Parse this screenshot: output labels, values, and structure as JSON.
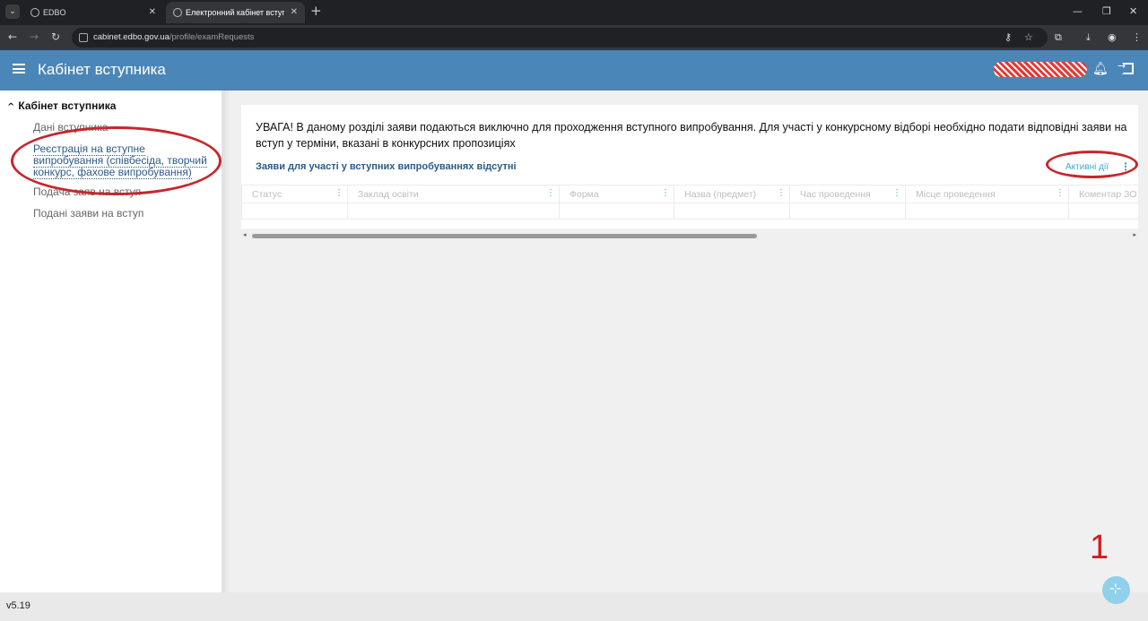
{
  "browser": {
    "tabs": [
      {
        "title": "EDBO"
      },
      {
        "title": "Електронний кабінет вступника"
      }
    ],
    "url_host": "cabinet.edbo.gov.ua",
    "url_path": "/profile/examRequests"
  },
  "header": {
    "title": "Кабінет вступника",
    "icons": [
      "menu-icon",
      "bell-icon",
      "logout-icon"
    ]
  },
  "sidebar": {
    "heading": "Кабінет вступника",
    "items": [
      {
        "label": "Дані вступника"
      },
      {
        "label": "Реєстрація на вступне випробування (співбесіда, творчий конкурс, фахове випробування)"
      },
      {
        "label": "Подача заяв на вступ"
      },
      {
        "label": "Подані заяви на вступ"
      }
    ]
  },
  "main": {
    "warning": "УВАГА! В даному розділі заяви подаються виключно для проходження вступного випробування. Для участі у конкурсному відборі необхідно подати відповідні заяви на вступ у терміни, вказані в конкурсних пропозиціях",
    "empty_title": "Заяви для участі у вступних випробуваннях відсутні",
    "actions_label": "Активні дії",
    "columns": [
      "Статус",
      "Заклад освіти",
      "Форма",
      "Назва (предмет)",
      "Час проведення",
      "Місце проведення",
      "Коментар ЗО"
    ]
  },
  "footer": {
    "version": "v5.19"
  },
  "annotation": {
    "number": "1",
    "color": "#d71920"
  },
  "colors": {
    "appbar": "#4a86b8",
    "accent": "#3aaad8",
    "link": "#2c5a86"
  }
}
